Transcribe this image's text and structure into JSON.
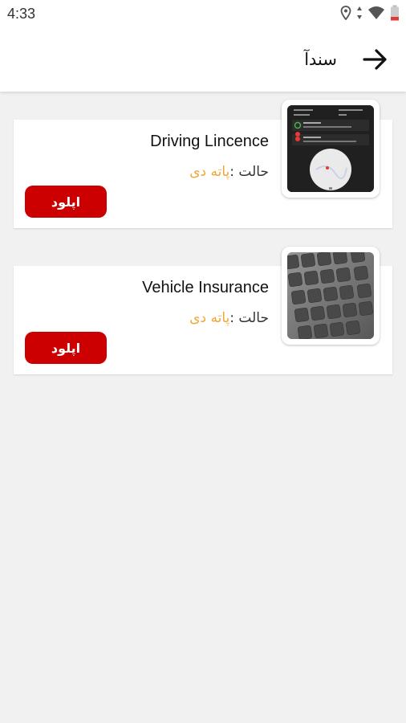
{
  "status_bar": {
    "time": "4:33",
    "icons": [
      "location-icon",
      "data-arrows-icon",
      "wifi-icon",
      "battery-icon"
    ]
  },
  "header": {
    "title": "سندآ",
    "back_icon": "arrow-right-icon"
  },
  "documents": [
    {
      "title": "Driving Lincence",
      "status_label": "حالت :",
      "status_value": "پاته دی",
      "upload_label": "اپلود",
      "thumbnail": "app-screenshot-thumbnail"
    },
    {
      "title": "Vehicle Insurance",
      "status_label": "حالت :",
      "status_value": "پاته دی",
      "upload_label": "اپلود",
      "thumbnail": "keyboard-photo-thumbnail"
    }
  ],
  "colors": {
    "accent": "#cc0000",
    "status_pending": "#f0a73a",
    "background": "#f1f1f1"
  }
}
